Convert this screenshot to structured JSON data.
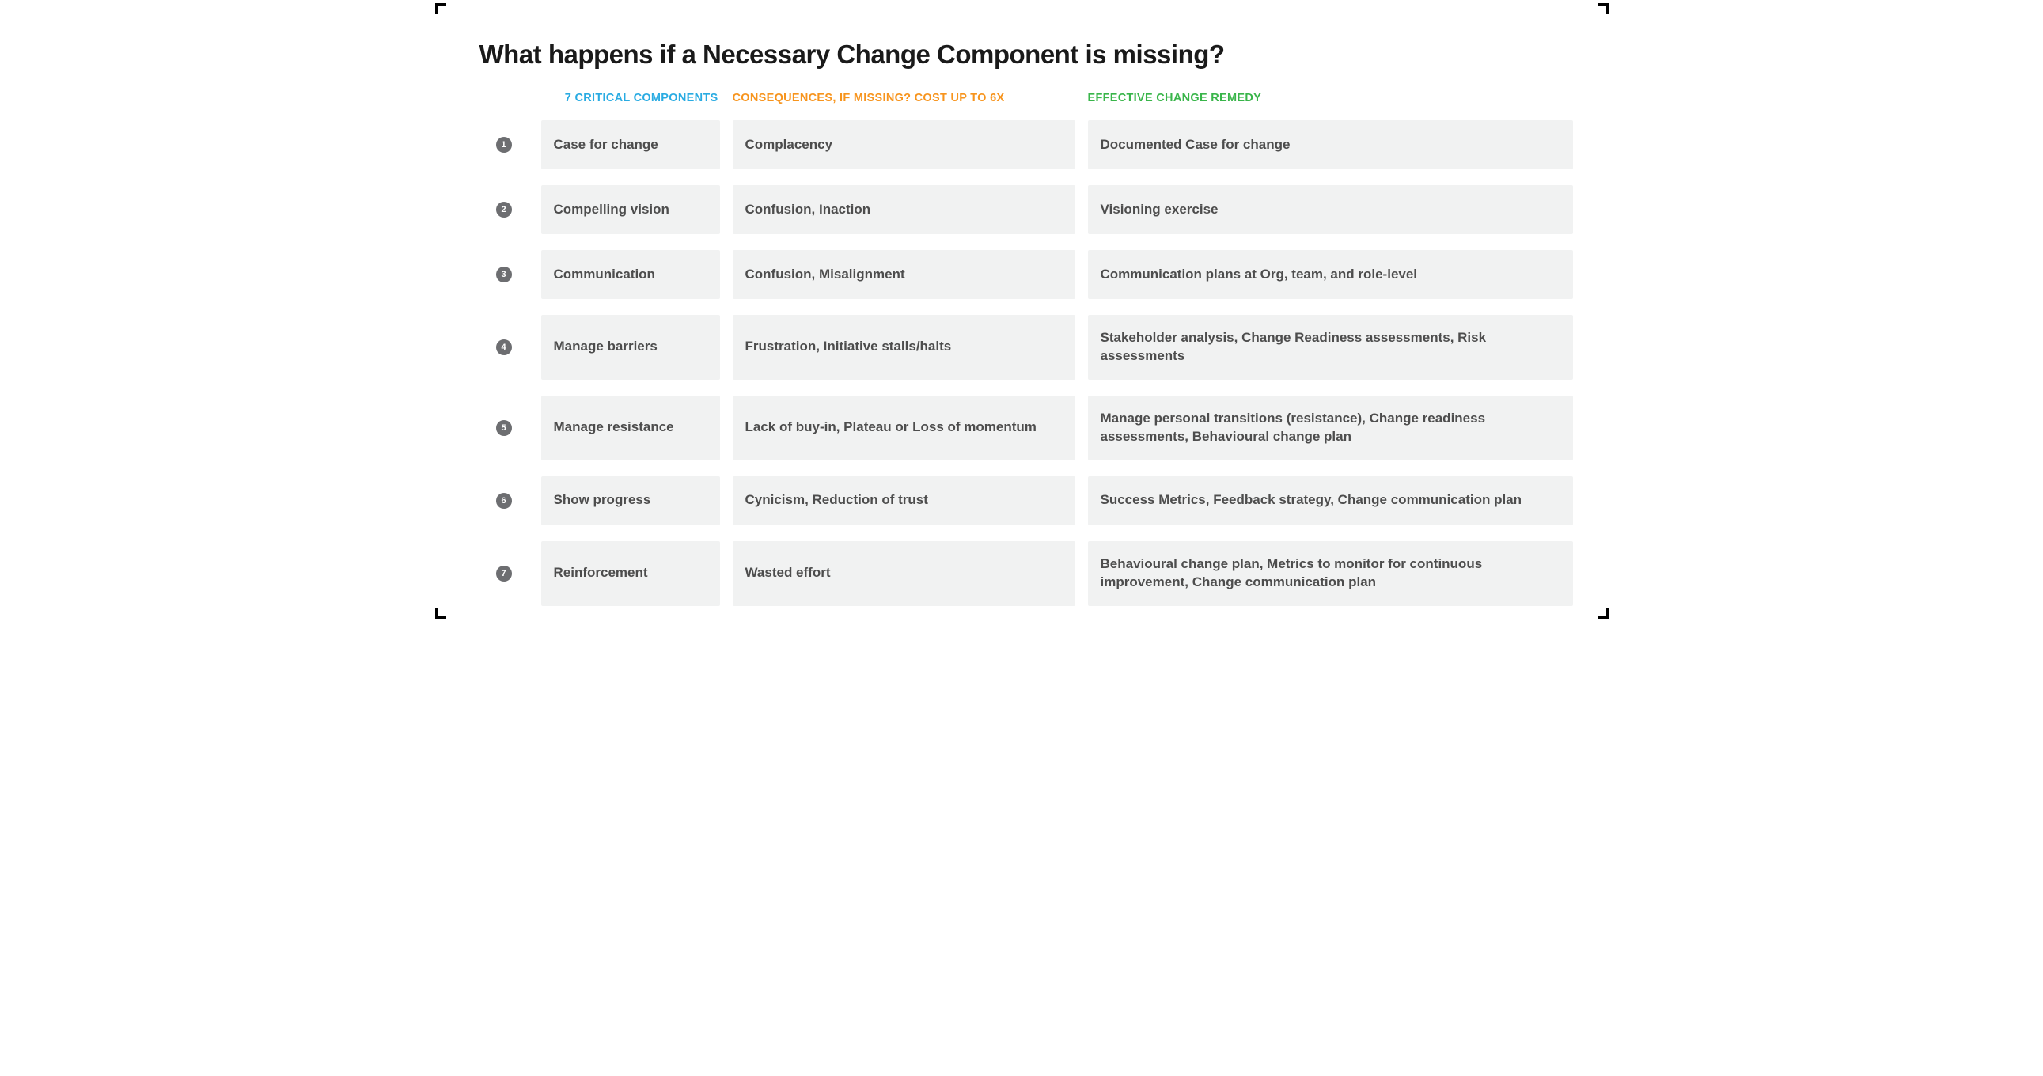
{
  "title": "What happens if a Necessary Change Component is missing?",
  "headers": {
    "components": "7 CRITICAL COMPONENTS",
    "consequences": "CONSEQUENCES, IF MISSING? COST UP TO 6X",
    "remedy": "EFFECTIVE CHANGE REMEDY"
  },
  "colors": {
    "components": "#29abe2",
    "consequences": "#f7941d",
    "remedy": "#39b54a",
    "cellBg": "#f1f2f2",
    "cellText": "#4d4d4d",
    "numBg": "#6d6e71"
  },
  "rows": [
    {
      "n": "1",
      "component": "Case for change",
      "consequence": "Complacency",
      "remedy": "Documented Case for change"
    },
    {
      "n": "2",
      "component": "Compelling vision",
      "consequence": "Confusion, Inaction",
      "remedy": "Visioning exercise"
    },
    {
      "n": "3",
      "component": "Communication",
      "consequence": "Confusion, Misalignment",
      "remedy": "Communication plans at Org, team, and role-level"
    },
    {
      "n": "4",
      "component": "Manage barriers",
      "consequence": "Frustration, Initiative stalls/halts",
      "remedy": "Stakeholder analysis, Change Readiness assessments, Risk assessments"
    },
    {
      "n": "5",
      "component": "Manage resistance",
      "consequence": "Lack of buy-in, Plateau or Loss of momentum",
      "remedy": "Manage personal transitions (resistance), Change readiness assessments, Behavioural change plan"
    },
    {
      "n": "6",
      "component": "Show progress",
      "consequence": "Cynicism, Reduction of trust",
      "remedy": "Success Metrics, Feedback strategy, Change communication plan"
    },
    {
      "n": "7",
      "component": "Reinforcement",
      "consequence": "Wasted effort",
      "remedy": "Behavioural change plan, Metrics to monitor for continuous improvement, Change communication plan"
    }
  ]
}
